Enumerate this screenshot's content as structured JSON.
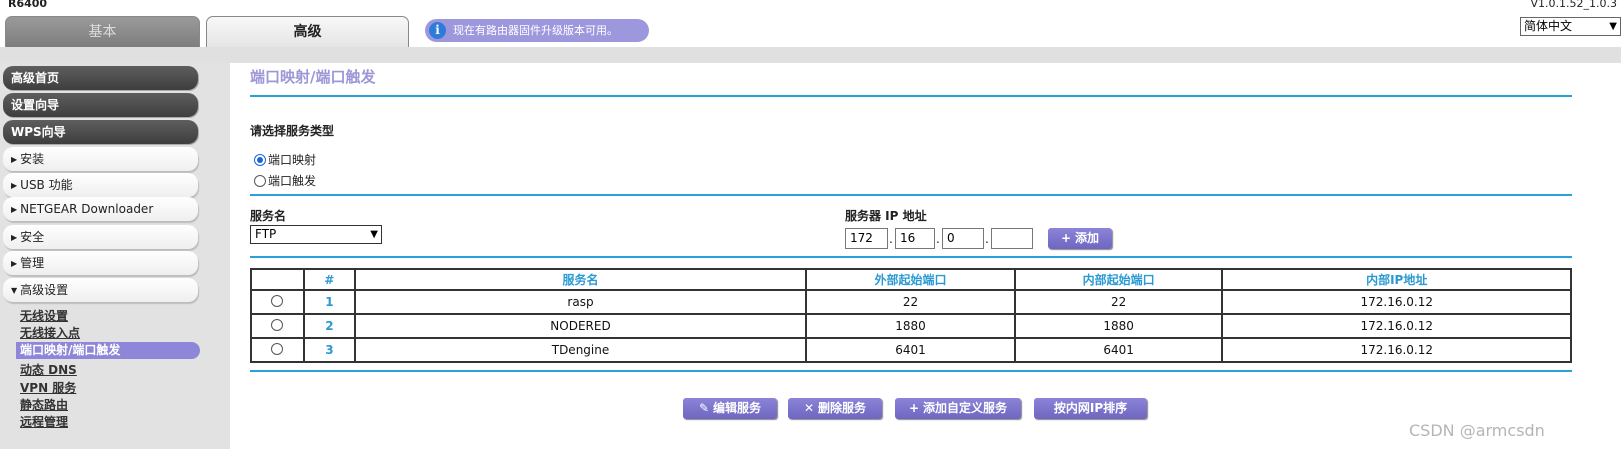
{
  "header": {
    "model": "R6400",
    "version": "V1.0.1.52_1.0.3",
    "tabs": [
      {
        "label": "基本",
        "active": false
      },
      {
        "label": "高级",
        "active": true
      }
    ],
    "notice": "现在有路由器固件升级版本可用。",
    "language": "简体中文"
  },
  "sidebar": {
    "main_items": [
      "高级首页",
      "设置向导",
      "WPS向导"
    ],
    "sections": [
      {
        "label": "安装",
        "expanded": false
      },
      {
        "label": "USB 功能",
        "expanded": false
      },
      {
        "label": "NETGEAR Downloader",
        "expanded": false
      },
      {
        "label": "安全",
        "expanded": false
      },
      {
        "label": "管理",
        "expanded": false
      },
      {
        "label": "高级设置",
        "expanded": true
      }
    ],
    "sub_items": [
      "无线设置",
      "无线接入点",
      "端口映射/端口触发",
      "动态 DNS",
      "VPN 服务",
      "静态路由",
      "远程管理"
    ],
    "active_sub_item": "端口映射/端口触发"
  },
  "main": {
    "title": "端口映射/端口触发",
    "service_type_label": "请选择服务类型",
    "service_type_options": [
      {
        "label": "端口映射",
        "checked": true
      },
      {
        "label": "端口触发",
        "checked": false
      }
    ],
    "service_name_label": "服务名",
    "service_name_value": "FTP",
    "server_ip_label": "服务器 IP 地址",
    "server_ip": [
      "172",
      "16",
      "0",
      ""
    ],
    "add_button": "添加",
    "table": {
      "headers": [
        "",
        "#",
        "服务名",
        "外部起始端口",
        "内部起始端口",
        "内部IP地址"
      ],
      "rows": [
        {
          "num": "1",
          "name": "rasp",
          "ext_port": "22",
          "int_port": "22",
          "ip": "172.16.0.12"
        },
        {
          "num": "2",
          "name": "NODERED",
          "ext_port": "1880",
          "int_port": "1880",
          "ip": "172.16.0.12"
        },
        {
          "num": "3",
          "name": "TDengine",
          "ext_port": "6401",
          "int_port": "6401",
          "ip": "172.16.0.12"
        }
      ]
    },
    "buttons": {
      "edit": "编辑服务",
      "delete": "删除服务",
      "add_custom": "添加自定义服务",
      "sort_by_ip": "按内网IP排序"
    }
  },
  "watermark": "CSDN @armcsdn"
}
